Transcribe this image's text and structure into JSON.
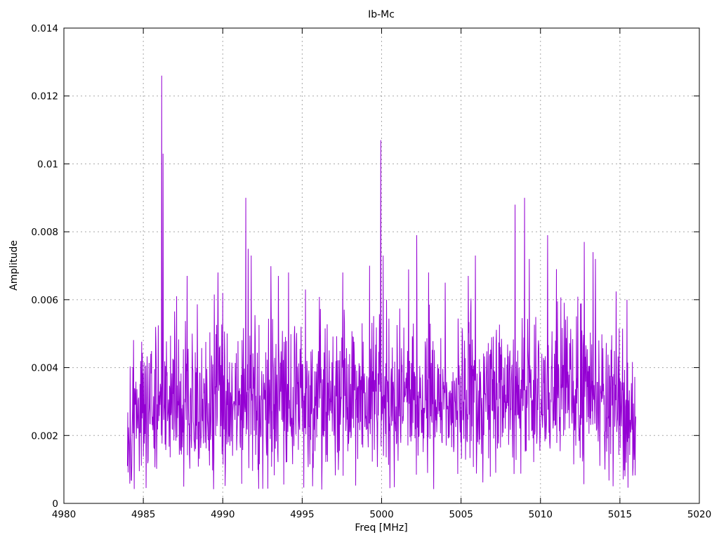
{
  "chart_data": {
    "type": "line",
    "title": "Ib-Mc",
    "xlabel": "Freq [MHz]",
    "ylabel": "Amplitude",
    "xlim": [
      4980,
      5020
    ],
    "ylim": [
      0,
      0.014
    ],
    "xticks": [
      4980,
      4985,
      4990,
      4995,
      5000,
      5005,
      5010,
      5015,
      5020
    ],
    "xtick_labels": [
      "4980",
      "4985",
      "4990",
      "4995",
      "5000",
      "5005",
      "5010",
      "5015",
      "5020"
    ],
    "yticks": [
      0,
      0.002,
      0.004,
      0.006,
      0.008,
      0.01,
      0.012,
      0.014
    ],
    "ytick_labels": [
      "0",
      "0.002",
      "0.004",
      "0.006",
      "0.008",
      "0.01",
      "0.012",
      "0.014"
    ],
    "grid": true,
    "legend": "none",
    "line_color": "#9400d3",
    "grid_color": "#a8a8a8",
    "frame_color": "#000000",
    "data_span": [
      4984.0,
      5016.0
    ],
    "n_points": 1500,
    "noise": {
      "seed": 42,
      "std": 0.00115,
      "min": 0.0004,
      "tail_prob": 0.03,
      "tail_max": 0.0026,
      "envelope": [
        [
          4984.0,
          0.0022
        ],
        [
          4985.0,
          0.0028
        ],
        [
          4986.5,
          0.003
        ],
        [
          4988.0,
          0.0028
        ],
        [
          4990.0,
          0.003
        ],
        [
          4992.0,
          0.003
        ],
        [
          4994.0,
          0.0028
        ],
        [
          4996.0,
          0.0029
        ],
        [
          4998.0,
          0.003
        ],
        [
          5000.0,
          0.003
        ],
        [
          5002.0,
          0.0029
        ],
        [
          5004.0,
          0.003
        ],
        [
          5006.0,
          0.003
        ],
        [
          5008.0,
          0.0031
        ],
        [
          5010.0,
          0.0032
        ],
        [
          5012.0,
          0.0033
        ],
        [
          5014.0,
          0.0032
        ],
        [
          5015.3,
          0.0026
        ],
        [
          5016.0,
          0.0014
        ]
      ]
    },
    "peaks": [
      [
        4986.15,
        0.0126
      ],
      [
        4986.25,
        0.0103
      ],
      [
        4987.1,
        0.0061
      ],
      [
        4987.75,
        0.0067
      ],
      [
        4989.7,
        0.0068
      ],
      [
        4990.0,
        0.0062
      ],
      [
        4991.45,
        0.009
      ],
      [
        4991.6,
        0.0075
      ],
      [
        4991.8,
        0.0073
      ],
      [
        4993.5,
        0.0067
      ],
      [
        4994.15,
        0.0068
      ],
      [
        4995.2,
        0.0063
      ],
      [
        4997.55,
        0.0068
      ],
      [
        4999.25,
        0.007
      ],
      [
        4999.95,
        0.0107
      ],
      [
        5000.1,
        0.0073
      ],
      [
        5000.3,
        0.006
      ],
      [
        5002.2,
        0.0079
      ],
      [
        5002.95,
        0.0068
      ],
      [
        5004.0,
        0.0065
      ],
      [
        5005.45,
        0.0067
      ],
      [
        5005.9,
        0.0073
      ],
      [
        5008.4,
        0.0088
      ],
      [
        5009.0,
        0.009
      ],
      [
        5009.3,
        0.0072
      ],
      [
        5010.45,
        0.0079
      ],
      [
        5011.0,
        0.0069
      ],
      [
        5012.75,
        0.0077
      ],
      [
        5013.3,
        0.0074
      ],
      [
        5013.45,
        0.0072
      ],
      [
        5015.45,
        0.006
      ]
    ]
  }
}
